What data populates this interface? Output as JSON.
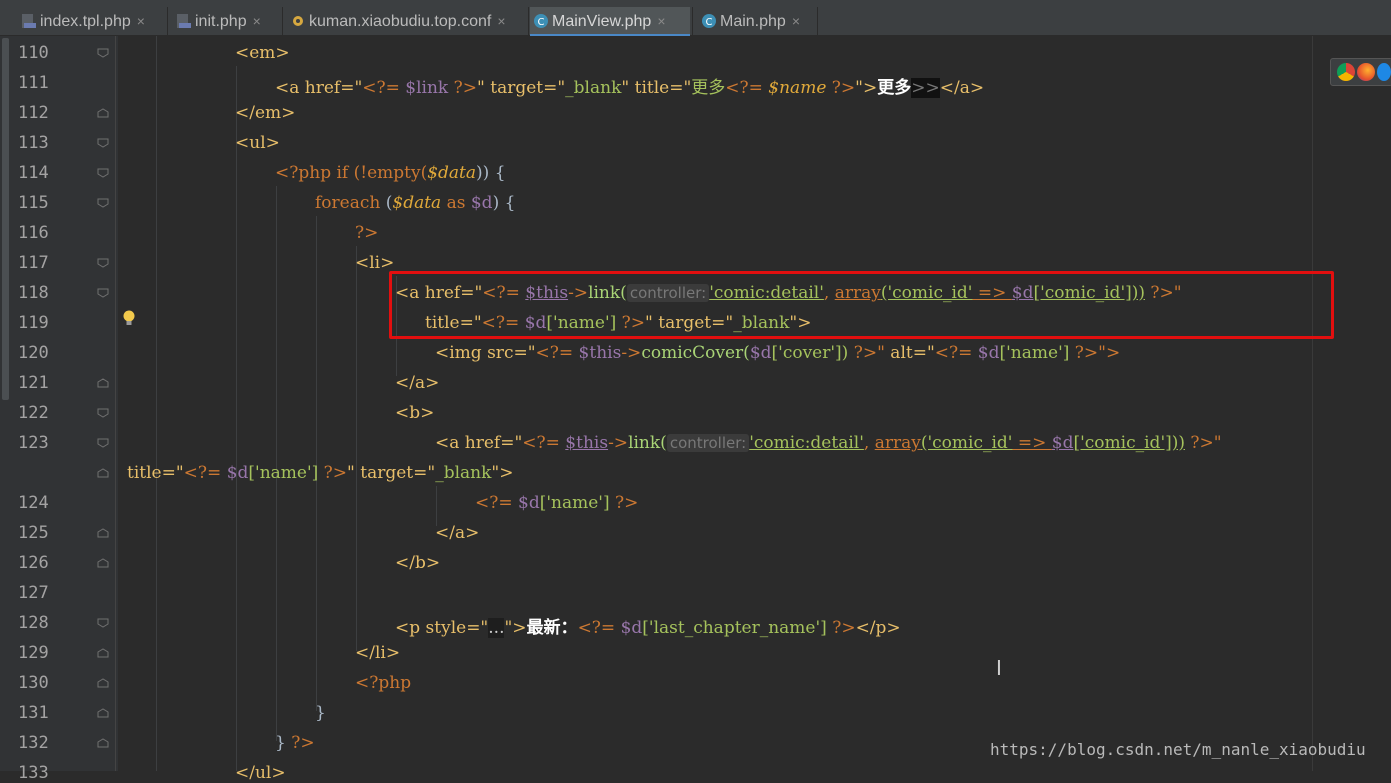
{
  "tabs": [
    {
      "label": "index.tpl.php",
      "icon": "php-file-icon"
    },
    {
      "label": "init.php",
      "icon": "php-file-icon"
    },
    {
      "label": "kuman.xiaobudiu.top.conf",
      "icon": "config-file-icon"
    },
    {
      "label": "MainView.php",
      "icon": "class-file-icon",
      "active": true
    },
    {
      "label": "Main.php",
      "icon": "class-file-icon"
    }
  ],
  "close_glyph": "×",
  "line_numbers": [
    "110",
    "111",
    "112",
    "113",
    "114",
    "115",
    "116",
    "117",
    "118",
    "119",
    "120",
    "121",
    "122",
    "123",
    "124",
    "125",
    "126",
    "127",
    "128",
    "129",
    "130",
    "131",
    "132",
    "133"
  ],
  "code": {
    "l110": "<em>",
    "l111_a": "<a href=\"",
    "l111_b": "<?= ",
    "l111_c": "$link",
    "l111_d": " ?>",
    "l111_e": "\" target=\"",
    "l111_f": "_blank",
    "l111_g": "\" title=\"",
    "l111_h": "更多",
    "l111_i": "<?= ",
    "l111_j": "$name",
    "l111_k": " ?>",
    "l111_l": "\">",
    "l111_m": "更多",
    "l111_n": ">>",
    "l111_o": "</a>",
    "l112": "</em>",
    "l113": "<ul>",
    "l114_a": "<?php",
    "l114_b": " if (!empty(",
    "l114_c": "$data",
    "l114_d": ")) {",
    "l115_a": "foreach",
    "l115_b": " (",
    "l115_c": "$data",
    "l115_d": " as ",
    "l115_e": "$d",
    "l115_f": ") {",
    "l116": "?>",
    "l117": "<li>",
    "l118_a": "<a href=\"",
    "l118_b": "<?= ",
    "l118_c": "$this",
    "l118_d": "->",
    "l118_e": "link(",
    "l118_hint": "controller:",
    "l118_f": "'comic:detail'",
    "l118_g": ", ",
    "l118_h": "array",
    "l118_i": "('comic_id'",
    "l118_j": " => ",
    "l118_k": "$d",
    "l118_l": "['comic_id']))",
    "l118_m": " ?>\"",
    "l119_a": "title=\"",
    "l119_b": "<?= ",
    "l119_c": "$d",
    "l119_d": "['name']",
    "l119_e": " ?>",
    "l119_f": "\" target=\"",
    "l119_g": "_blank",
    "l119_h": "\">",
    "l120_a": "<img src=\"",
    "l120_b": "<?= ",
    "l120_c": "$this",
    "l120_d": "->",
    "l120_e": "comicCover(",
    "l120_f": "$d",
    "l120_g": "['cover'])",
    "l120_h": " ?>\"",
    "l120_i": " alt=\"",
    "l120_j": "<?= ",
    "l120_k": "$d",
    "l120_l": "['name']",
    "l120_m": " ?>\">",
    "l121": "</a>",
    "l122": "<b>",
    "l123_a": "<a href=\"",
    "l123_b": "<?= ",
    "l123_c": "$this",
    "l123_d": "->",
    "l123_e": "link(",
    "l123_hint": "controller:",
    "l123_f": "'comic:detail'",
    "l123_g": ", ",
    "l123_h": "array",
    "l123_i": "('comic_id'",
    "l123_j": " => ",
    "l123_k": "$d",
    "l123_l": "['comic_id']))",
    "l123_m": " ?>\"",
    "l123w_a": "title=\"",
    "l123w_b": "<?= ",
    "l123w_c": "$d",
    "l123w_d": "['name']",
    "l123w_e": " ?>",
    "l123w_f": "\" target=\"",
    "l123w_g": "_blank",
    "l123w_h": "\">",
    "l124_a": "<?= ",
    "l124_b": "$d",
    "l124_c": "['name']",
    "l124_d": " ?>",
    "l125": "</a>",
    "l126": "</b>",
    "l128_a": "<p style=\"",
    "l128_b": "...",
    "l128_c": "\">",
    "l128_d": "最新：",
    "l128_e": "<?= ",
    "l128_f": "$d",
    "l128_g": "['last_chapter_name']",
    "l128_h": " ?>",
    "l128_i": "</p>",
    "l129": "</li>",
    "l130": "<?php",
    "l131": "}",
    "l132_a": "} ",
    "l132_b": "?>",
    "l133": "</ul>"
  },
  "watermark": "https://blog.csdn.net/m_nanle_xiaobudiu",
  "cursor_glyph": "I",
  "colors": {
    "background": "#2b2b2b",
    "tag": "#e8bf6a",
    "php_delim": "#cc7832",
    "variable": "#9876aa",
    "string": "#6a8759",
    "highlight_box": "#e20f0f"
  }
}
